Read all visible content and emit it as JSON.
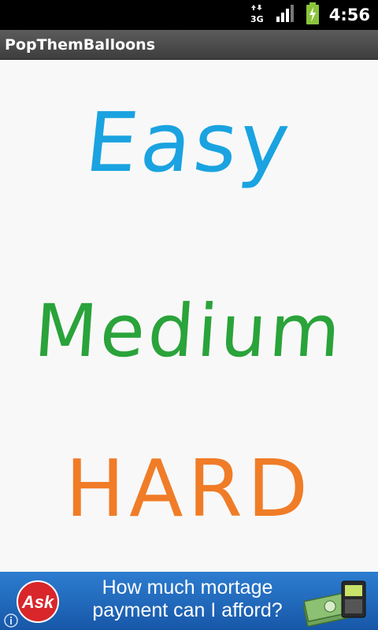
{
  "status_bar": {
    "time": "4:56",
    "network_label": "3G",
    "icons": [
      "data-transfer-icon",
      "signal-icon",
      "battery-charging-icon"
    ]
  },
  "app": {
    "title": "PopThemBalloons"
  },
  "levels": [
    {
      "label": "Easy",
      "color": "#1aa3e0"
    },
    {
      "label": "Medium",
      "color": "#2aa33a"
    },
    {
      "label": "HARD",
      "color": "#f07c27"
    }
  ],
  "ad": {
    "logo_text": "Ask",
    "line1": "How much mortage",
    "line2": "payment can I afford?",
    "icons": [
      "ask-logo-icon",
      "money-phone-icon",
      "info-icon"
    ]
  }
}
